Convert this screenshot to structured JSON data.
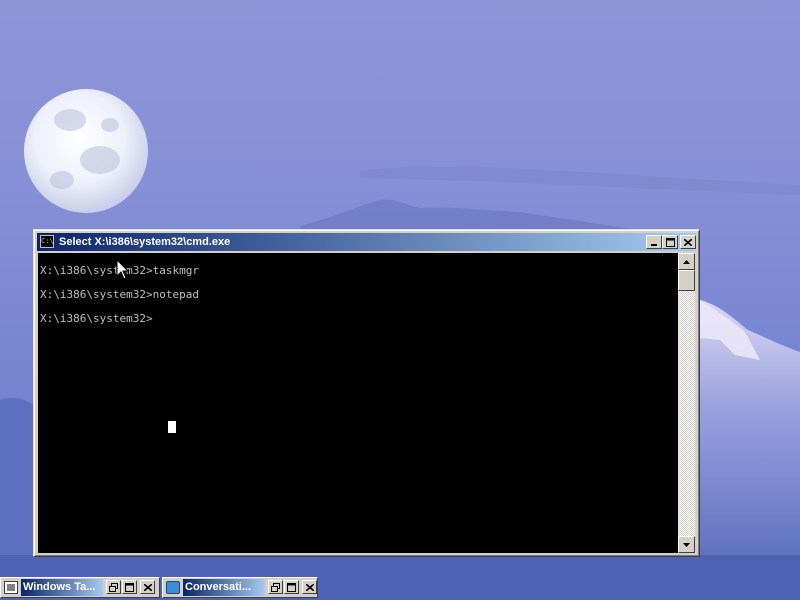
{
  "window": {
    "title": "Select X:\\i386\\system32\\cmd.exe",
    "icon_name": "console-icon",
    "icon_text": "C:\\"
  },
  "console": {
    "lines": [
      "X:\\i386\\system32>taskmgr",
      "X:\\i386\\system32>notepad",
      "X:\\i386\\system32>"
    ],
    "background_color": "#000000",
    "text_color": "#c0c0c0"
  },
  "taskbar": {
    "buttons": [
      {
        "title": "Windows Ta...",
        "icon": "task-manager-icon"
      },
      {
        "title": "Conversati...",
        "icon": "notepad-icon"
      }
    ]
  },
  "colors": {
    "titlebar_active_start": "#0a246a",
    "titlebar_active_end": "#a6caf0",
    "button_face": "#d4d0c8"
  }
}
